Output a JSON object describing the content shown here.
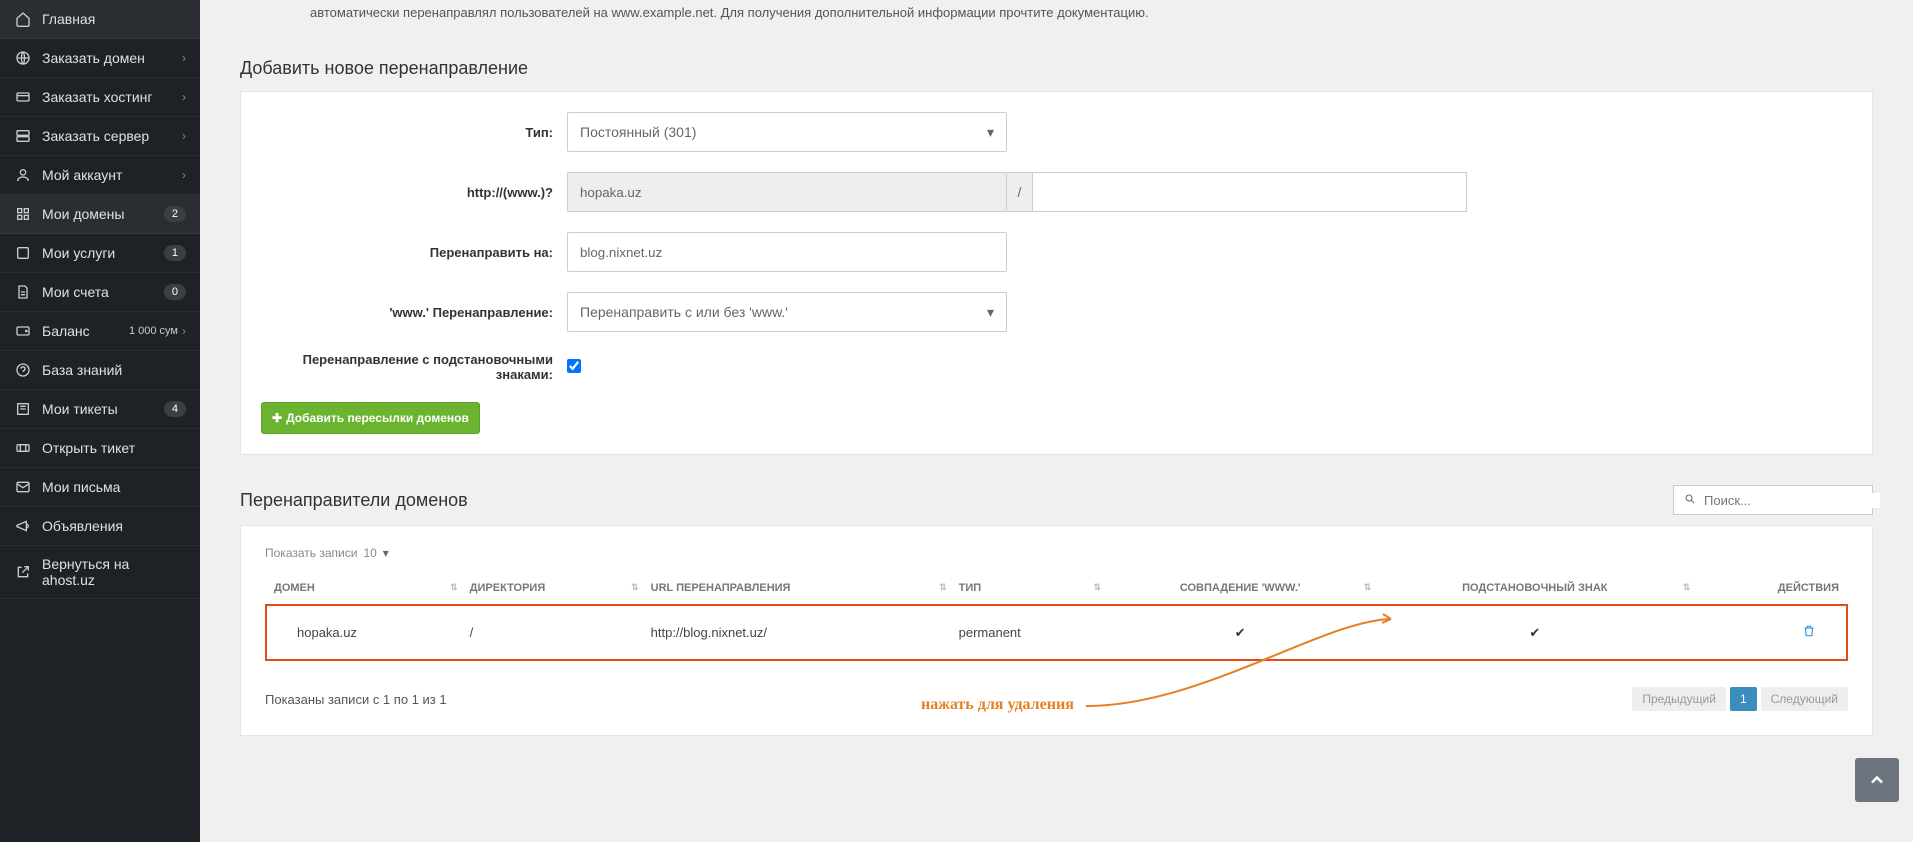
{
  "sidebar": {
    "items": [
      {
        "label": "Главная",
        "icon": "home-icon",
        "badge": null,
        "chev": false,
        "tail": null
      },
      {
        "label": "Заказать домен",
        "icon": "globe-icon",
        "badge": null,
        "chev": true,
        "tail": null
      },
      {
        "label": "Заказать хостинг",
        "icon": "card-icon",
        "badge": null,
        "chev": true,
        "tail": null
      },
      {
        "label": "Заказать сервер",
        "icon": "server-icon",
        "badge": null,
        "chev": true,
        "tail": null
      },
      {
        "label": "Мой аккаунт",
        "icon": "user-icon",
        "badge": null,
        "chev": true,
        "tail": null
      },
      {
        "label": "Мои домены",
        "icon": "grid-icon",
        "badge": "2",
        "chev": false,
        "tail": null
      },
      {
        "label": "Мои услуги",
        "icon": "services-icon",
        "badge": "1",
        "chev": false,
        "tail": null
      },
      {
        "label": "Мои счета",
        "icon": "invoice-icon",
        "badge": "0",
        "chev": false,
        "tail": null
      },
      {
        "label": "Баланс",
        "icon": "wallet-icon",
        "badge": null,
        "chev": true,
        "tail": "1 000 сум"
      },
      {
        "label": "База знаний",
        "icon": "help-icon",
        "badge": null,
        "chev": false,
        "tail": null
      },
      {
        "label": "Мои тикеты",
        "icon": "ticket-icon",
        "badge": "4",
        "chev": false,
        "tail": null
      },
      {
        "label": "Открыть тикет",
        "icon": "open-ticket-icon",
        "badge": null,
        "chev": false,
        "tail": null
      },
      {
        "label": "Мои письма",
        "icon": "mail-icon",
        "badge": null,
        "chev": false,
        "tail": null
      },
      {
        "label": "Объявления",
        "icon": "announce-icon",
        "badge": null,
        "chev": false,
        "tail": null
      },
      {
        "label": "Вернуться на ahost.uz",
        "icon": "external-icon",
        "badge": null,
        "chev": false,
        "tail": null
      }
    ],
    "active_index": 5
  },
  "top_text": "автоматически перенаправлял пользователей на www.example.net. Для получения дополнительной информации прочтите документацию.",
  "form": {
    "heading": "Добавить новое перенаправление",
    "labels": {
      "type": "Тип:",
      "http": "http://(www.)?",
      "redirect_to": "Перенаправить на:",
      "www_redirect": "'www.' Перенаправление:",
      "wildcard": "Перенаправление с подстановочными знаками:"
    },
    "values": {
      "type_sel": "Постоянный (301)",
      "domain": "hopaka.uz",
      "slash": "/",
      "redirect_to_val": "blog.nixnet.uz",
      "www_sel": "Перенаправить с или без 'www.'",
      "wildcard_checked": true
    },
    "submit_label": "Добавить пересылки доменов"
  },
  "table_section": {
    "heading": "Перенаправители доменов",
    "search_placeholder": "Поиск...",
    "show_label": "Показать записи",
    "show_value": "10",
    "columns": [
      "ДОМЕН",
      "ДИРЕКТОРИЯ",
      "URL ПЕРЕНАПРАВЛЕНИЯ",
      "ТИП",
      "СОВПАДЕНИЕ 'WWW.'",
      "ПОДСТАНОВОЧНЫЙ ЗНАК",
      "ДЕЙСТВИЯ"
    ],
    "rows": [
      {
        "domain": "hopaka.uz",
        "dir": "/",
        "url": "http://blog.nixnet.uz/",
        "type": "permanent",
        "www": true,
        "wildcard": true
      }
    ],
    "footer_info": "Показаны записи с 1 по 1 из 1",
    "pager": {
      "prev": "Предыдущий",
      "pages": [
        "1"
      ],
      "next": "Следующий"
    }
  },
  "annotation": "нажать для удаления"
}
